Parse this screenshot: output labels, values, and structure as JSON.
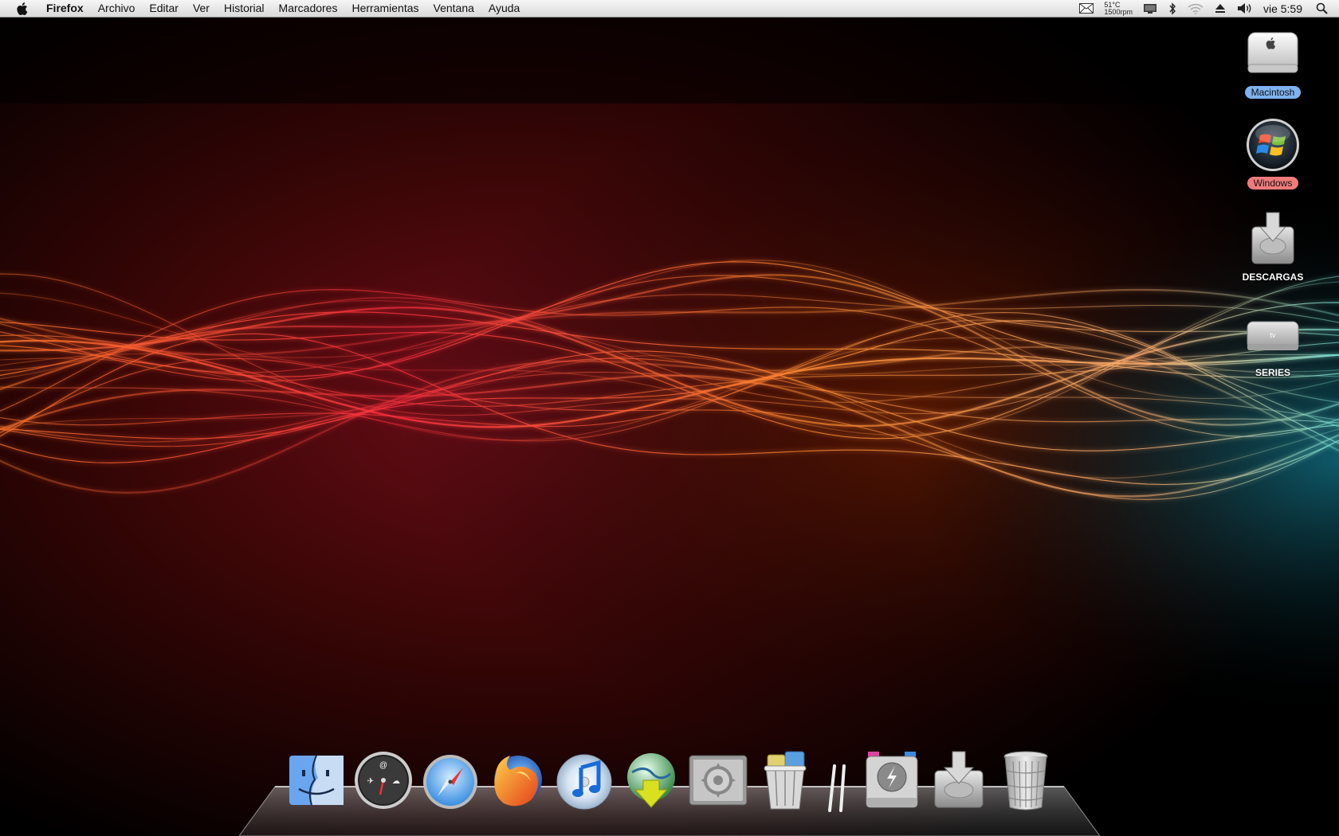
{
  "menubar": {
    "app_name": "Firefox",
    "menus": [
      "Archivo",
      "Editar",
      "Ver",
      "Historial",
      "Marcadores",
      "Herramientas",
      "Ventana",
      "Ayuda"
    ],
    "status": {
      "temperature": "51°C",
      "fan_speed": "1500rpm",
      "clock": "vie 5:59",
      "icons": [
        "mail-icon",
        "display-icon",
        "bluetooth-icon",
        "wifi-icon",
        "eject-icon",
        "volume-icon",
        "spotlight-icon"
      ]
    }
  },
  "desktop_icons": [
    {
      "label": "Macintosh",
      "icon": "mac-mini-drive-icon",
      "label_color": "#7fb2ef"
    },
    {
      "label": "Windows",
      "icon": "windows-drive-icon",
      "label_color": "#f07b7b"
    },
    {
      "label": "DESCARGAS",
      "icon": "downloads-drive-icon"
    },
    {
      "label": "SERIES",
      "icon": "apple-tv-drive-icon"
    }
  ],
  "dock": {
    "apps": [
      "finder-icon",
      "dashboard-icon",
      "safari-icon",
      "firefox-icon",
      "itunes-icon",
      "transmission-icon",
      "system-preferences-icon",
      "cleaner-trash-icon"
    ],
    "stacks": [
      "applications-stack-icon",
      "downloads-stack-icon",
      "trash-icon"
    ]
  },
  "colors": {
    "wallpaper_left": "#5a0c12",
    "wallpaper_center": "#2a0505",
    "wallpaper_right": "#0a3a48",
    "wave_red": "#ff3b3b",
    "wave_orange": "#ff8a2a",
    "wave_teal": "#7fe0d8"
  }
}
